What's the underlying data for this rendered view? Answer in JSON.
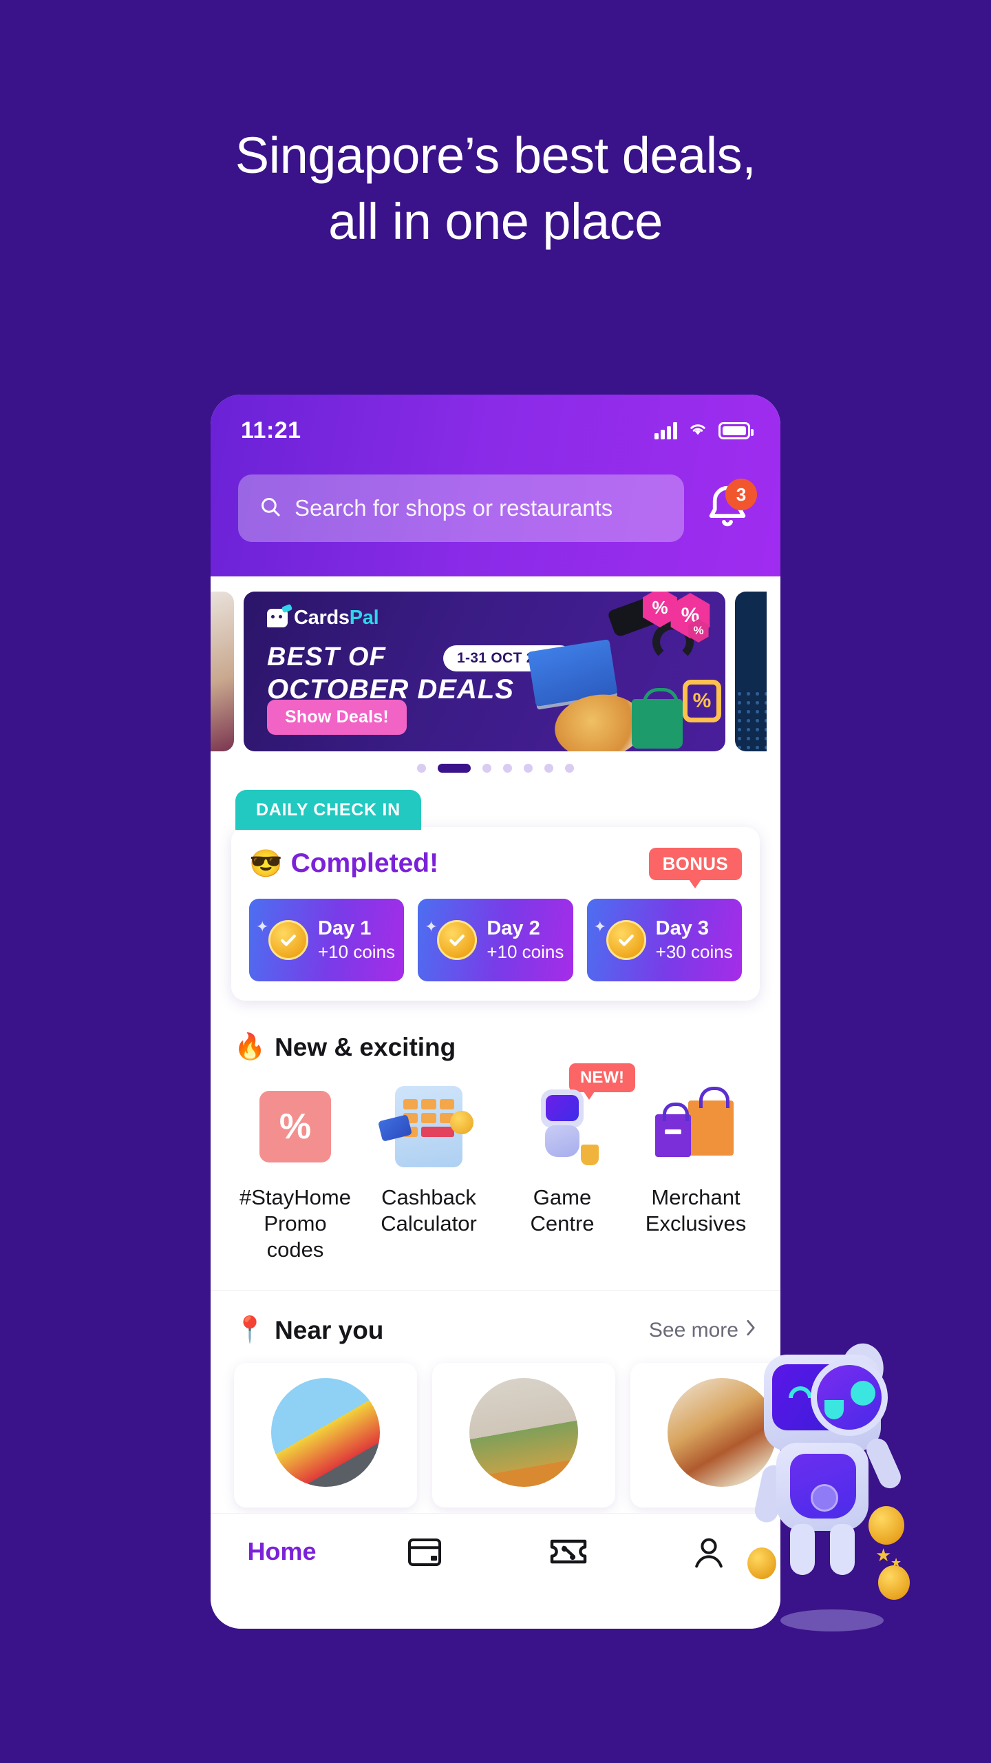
{
  "promo": {
    "headline_line1": "Singapore’s best deals,",
    "headline_line2": "all in one place",
    "background_color": "#3A1289"
  },
  "phone": {
    "statusbar": {
      "time": "11:21",
      "signal_icon": "signal-bars-icon",
      "wifi_icon": "wifi-icon",
      "battery_icon": "battery-icon"
    },
    "header": {
      "search_placeholder": "Search for shops or restaurants",
      "search_icon": "search-icon",
      "notification_icon": "bell-icon",
      "notification_count": "3",
      "gradient_from": "#6A22D6",
      "gradient_to": "#A02CF0"
    },
    "carousel": {
      "banner": {
        "logo_text": "Cards",
        "logo_accent": "Pal",
        "title_line1": "BEST OF",
        "title_line2": "OCTOBER DEALS",
        "date_badge": "1-31 OCT 2021",
        "cta_label": "Show Deals!",
        "cta_color": "#F263C6"
      },
      "dots_total": 7,
      "dots_active_index": 1
    },
    "daily_checkin": {
      "tab_label": "DAILY CHECK IN",
      "tab_color": "#21C9C0",
      "status_emoji": "😎",
      "status_text": "Completed!",
      "status_color": "#7B22D8",
      "bonus_label": "BONUS",
      "bonus_color": "#FB6565",
      "days": [
        {
          "day": "Day 1",
          "coins": "+10 coins",
          "checked": true
        },
        {
          "day": "Day 2",
          "coins": "+10 coins",
          "checked": true
        },
        {
          "day": "Day 3",
          "coins": "+30 coins",
          "checked": true
        }
      ]
    },
    "new_exciting": {
      "emoji": "🔥",
      "title": "New & exciting",
      "items": [
        {
          "label_line1": "#StayHome",
          "label_line2": "Promo codes",
          "icon": "promo-code-icon",
          "badge": ""
        },
        {
          "label_line1": "Cashback",
          "label_line2": "Calculator",
          "icon": "calculator-icon",
          "badge": ""
        },
        {
          "label_line1": "Game",
          "label_line2": "Centre",
          "icon": "robot-game-icon",
          "badge": "NEW!"
        },
        {
          "label_line1": "Merchant",
          "label_line2": "Exclusives",
          "icon": "shopping-bags-icon",
          "badge": ""
        }
      ]
    },
    "near_you": {
      "emoji": "📍",
      "title": "Near you",
      "see_more_label": "See more",
      "chevron_icon": "chevron-right-icon",
      "cards": [
        {
          "image": "shell-station-photo"
        },
        {
          "image": "home-interior-photo"
        },
        {
          "image": "food-spread-photo"
        }
      ]
    },
    "bottom_nav": [
      {
        "label": "Home",
        "icon": "home-label",
        "active": true
      },
      {
        "label": "",
        "icon": "card-icon",
        "active": false
      },
      {
        "label": "",
        "icon": "voucher-percent-icon",
        "active": false
      },
      {
        "label": "",
        "icon": "person-icon",
        "active": false
      }
    ]
  },
  "mascot": {
    "name": "robot-mascot",
    "accent": "#3CE6E0"
  }
}
